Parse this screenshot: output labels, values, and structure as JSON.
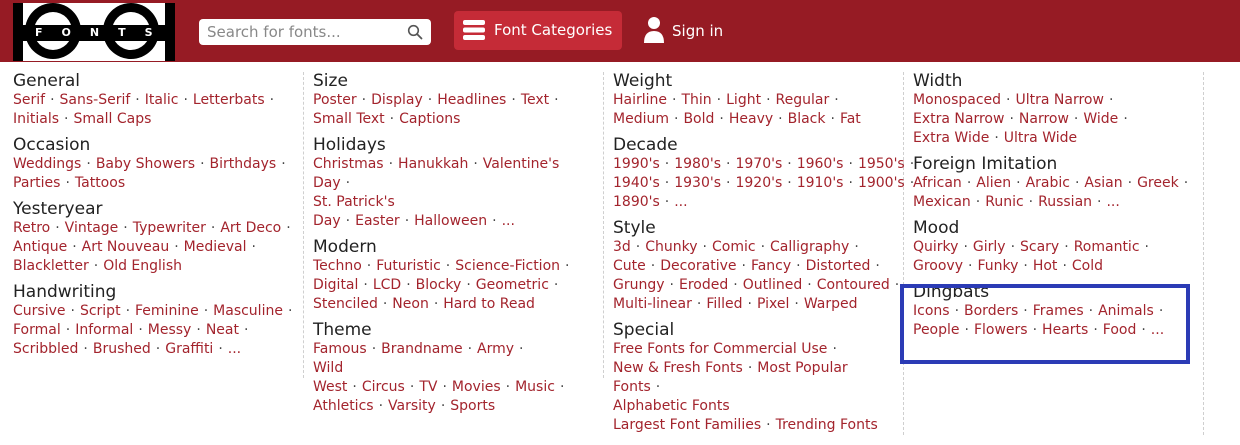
{
  "header": {
    "logo_text": "FONTS",
    "search_placeholder": "Search for fonts...",
    "categories_label": "Font Categories",
    "signin_label": "Sign in"
  },
  "colors": {
    "header_bg": "#961b24",
    "button_bg": "#c52b37",
    "link": "#a3242d",
    "highlight": "#2b3bb5"
  },
  "columns": [
    [
      {
        "title": "General",
        "lines": [
          [
            "Serif",
            "Sans-Serif",
            "Italic",
            "Letterbats"
          ],
          [
            "Initials",
            "Small Caps"
          ]
        ],
        "trail": [
          true,
          false
        ]
      },
      {
        "title": "Occasion",
        "lines": [
          [
            "Weddings",
            "Baby Showers",
            "Birthdays"
          ],
          [
            "Parties",
            "Tattoos"
          ]
        ],
        "trail": [
          true,
          false
        ]
      },
      {
        "title": "Yesteryear",
        "lines": [
          [
            "Retro",
            "Vintage",
            "Typewriter",
            "Art Deco"
          ],
          [
            "Antique",
            "Art Nouveau",
            "Medieval"
          ],
          [
            "Blackletter",
            "Old English"
          ]
        ],
        "trail": [
          true,
          true,
          false
        ]
      },
      {
        "title": "Handwriting",
        "lines": [
          [
            "Cursive",
            "Script",
            "Feminine",
            "Masculine"
          ],
          [
            "Formal",
            "Informal",
            "Messy",
            "Neat"
          ],
          [
            "Scribbled",
            "Brushed",
            "Graffiti",
            "..."
          ]
        ],
        "trail": [
          true,
          true,
          false
        ]
      }
    ],
    [
      {
        "title": "Size",
        "lines": [
          [
            "Poster",
            "Display",
            "Headlines",
            "Text"
          ],
          [
            "Small Text",
            "Captions"
          ]
        ],
        "trail": [
          true,
          false
        ]
      },
      {
        "title": "Holidays",
        "lines": [
          [
            "Christmas",
            "Hanukkah",
            "Valentine's Day"
          ],
          [
            "St. Patrick's Day",
            "Easter",
            "Halloween",
            "..."
          ]
        ],
        "trail": [
          true,
          false
        ]
      },
      {
        "title": "Modern",
        "lines": [
          [
            "Techno",
            "Futuristic",
            "Science-Fiction"
          ],
          [
            "Digital",
            "LCD",
            "Blocky",
            "Geometric"
          ],
          [
            "Stenciled",
            "Neon",
            "Hard to Read"
          ]
        ],
        "trail": [
          true,
          true,
          false
        ]
      },
      {
        "title": "Theme",
        "lines": [
          [
            "Famous",
            "Brandname",
            "Army"
          ],
          [
            "Wild West",
            "Circus",
            "TV",
            "Movies",
            "Music"
          ],
          [
            "Athletics",
            "Varsity",
            "Sports"
          ]
        ],
        "trail": [
          true,
          true,
          false
        ]
      }
    ],
    [
      {
        "title": "Weight",
        "lines": [
          [
            "Hairline",
            "Thin",
            "Light",
            "Regular"
          ],
          [
            "Medium",
            "Bold",
            "Heavy",
            "Black",
            "Fat"
          ]
        ],
        "trail": [
          true,
          false
        ]
      },
      {
        "title": "Decade",
        "lines": [
          [
            "1990's",
            "1980's",
            "1970's",
            "1960's",
            "1950's"
          ],
          [
            "1940's",
            "1930's",
            "1920's",
            "1910's",
            "1900's"
          ],
          [
            "1890's",
            "..."
          ]
        ],
        "trail": [
          true,
          true,
          false
        ]
      },
      {
        "title": "Style",
        "lines": [
          [
            "3d",
            "Chunky",
            "Comic",
            "Calligraphy"
          ],
          [
            "Cute",
            "Decorative",
            "Fancy",
            "Distorted"
          ],
          [
            "Grungy",
            "Eroded",
            "Outlined",
            "Contoured"
          ],
          [
            "Multi-linear",
            "Filled",
            "Pixel",
            "Warped"
          ]
        ],
        "trail": [
          true,
          true,
          true,
          false
        ]
      },
      {
        "title": "Special",
        "lines": [
          [
            "Free Fonts for Commercial Use"
          ],
          [
            "New & Fresh Fonts",
            "Most Popular Fonts"
          ],
          [
            "Alphabetic Fonts"
          ],
          [
            "Largest Font Families",
            "Trending Fonts"
          ]
        ],
        "trail": [
          true,
          true,
          false,
          false
        ]
      }
    ],
    [
      {
        "title": "Width",
        "lines": [
          [
            "Monospaced",
            "Ultra Narrow"
          ],
          [
            "Extra Narrow",
            "Narrow",
            "Wide"
          ],
          [
            "Extra Wide",
            "Ultra Wide"
          ]
        ],
        "trail": [
          true,
          true,
          false
        ]
      },
      {
        "title": "Foreign Imitation",
        "lines": [
          [
            "African",
            "Alien",
            "Arabic",
            "Asian",
            "Greek"
          ],
          [
            "Mexican",
            "Runic",
            "Russian",
            "..."
          ]
        ],
        "trail": [
          true,
          false
        ]
      },
      {
        "title": "Mood",
        "lines": [
          [
            "Quirky",
            "Girly",
            "Scary",
            "Romantic"
          ],
          [
            "Groovy",
            "Funky",
            "Hot",
            "Cold"
          ]
        ],
        "trail": [
          true,
          false
        ]
      },
      {
        "title": "Dingbats",
        "lines": [
          [
            "Icons",
            "Borders",
            "Frames",
            "Animals"
          ],
          [
            "People",
            "Flowers",
            "Hearts",
            "Food",
            "..."
          ]
        ],
        "trail": [
          true,
          false
        ]
      }
    ]
  ]
}
